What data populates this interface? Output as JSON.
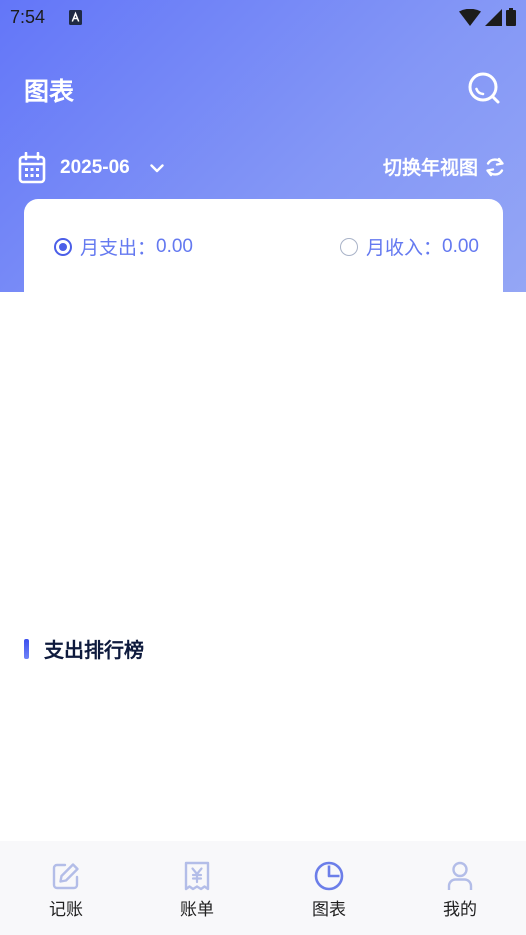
{
  "status_bar": {
    "time": "7:54"
  },
  "header": {
    "title": "图表"
  },
  "date_selector": {
    "value": "2025-06"
  },
  "view_switch": {
    "label": "切换年视图"
  },
  "summary": {
    "expense": {
      "label": "月支出：",
      "value": "0.00",
      "selected": true
    },
    "income": {
      "label": "月收入：",
      "value": "0.00",
      "selected": false
    }
  },
  "ranking": {
    "title": "支出排行榜"
  },
  "tabbar": {
    "items": [
      {
        "label": "记账",
        "icon": "edit-icon",
        "active": false
      },
      {
        "label": "账单",
        "icon": "receipt-icon",
        "active": false
      },
      {
        "label": "图表",
        "icon": "pie-chart-icon",
        "active": true
      },
      {
        "label": "我的",
        "icon": "person-icon",
        "active": false
      }
    ]
  },
  "colors": {
    "accent": "#6376f8",
    "accent_text": "#6479f0",
    "inactive_icon": "#b3bde8",
    "tab_active": "#6c7ee9"
  }
}
